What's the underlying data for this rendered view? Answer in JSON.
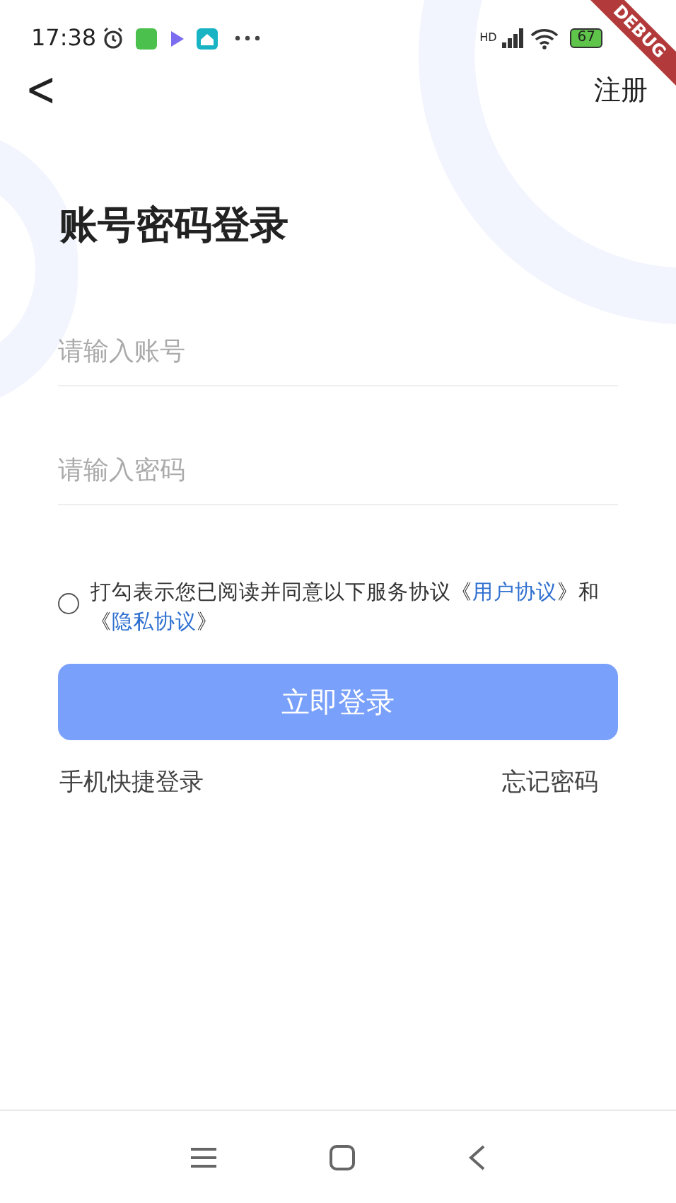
{
  "status_bar": {
    "time": "17:38",
    "battery": "67",
    "network": "HD"
  },
  "debug_banner": "DEBUG",
  "header": {
    "back": "<",
    "action": "注册"
  },
  "title": "账号密码登录",
  "fields": [
    {
      "placeholder": "请输入账号"
    },
    {
      "placeholder": "请输入密码"
    }
  ],
  "agreement": {
    "checked": false,
    "parts": [
      {
        "kind": "text",
        "text": "打勾表示您已阅读并同意以下服务协议《"
      },
      {
        "kind": "link",
        "text": "用户协议"
      },
      {
        "kind": "text",
        "text": "》和《"
      },
      {
        "kind": "link",
        "text": "隐私协议"
      },
      {
        "kind": "text",
        "text": "》"
      }
    ]
  },
  "login_button": "立即登录",
  "links": [
    "手机快捷登录",
    "忘记密码"
  ]
}
